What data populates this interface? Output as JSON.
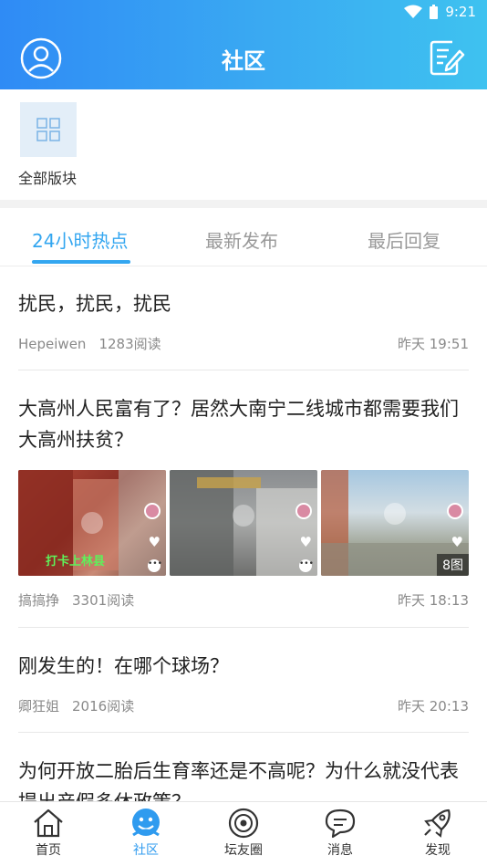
{
  "status": {
    "time": "9:21"
  },
  "header": {
    "title": "社区"
  },
  "sections": {
    "all_label": "全部版块"
  },
  "tabs": [
    {
      "label": "24小时热点",
      "active": true
    },
    {
      "label": "最新发布",
      "active": false
    },
    {
      "label": "最后回复",
      "active": false
    }
  ],
  "posts": [
    {
      "title": "扰民，扰民，扰民",
      "author": "Hepeiwen",
      "views": "1283阅读",
      "time": "昨天 19:51"
    },
    {
      "title": "大高州人民富有了？居然大南宁二线城市都需要我们大高州扶贫？",
      "author": "搞搞挣",
      "views": "3301阅读",
      "time": "昨天 18:13",
      "image_count": "8图",
      "image_caption": "打卡上林县"
    },
    {
      "title": "刚发生的！在哪个球场？",
      "author": "卿狂姐",
      "views": "2016阅读",
      "time": "昨天 20:13"
    },
    {
      "title": "为何开放二胎后生育率还是不高呢？为什么就没代表提出产假多休政策？"
    }
  ],
  "nav": [
    {
      "label": "首页",
      "icon": "home-icon"
    },
    {
      "label": "社区",
      "icon": "community-icon",
      "active": true
    },
    {
      "label": "坛友圈",
      "icon": "forum-circle-icon"
    },
    {
      "label": "消息",
      "icon": "message-icon"
    },
    {
      "label": "发现",
      "icon": "rocket-icon"
    }
  ],
  "colors": {
    "accent": "#33a6f0",
    "header_start": "#2f8bf5",
    "header_end": "#3ec2f0"
  }
}
